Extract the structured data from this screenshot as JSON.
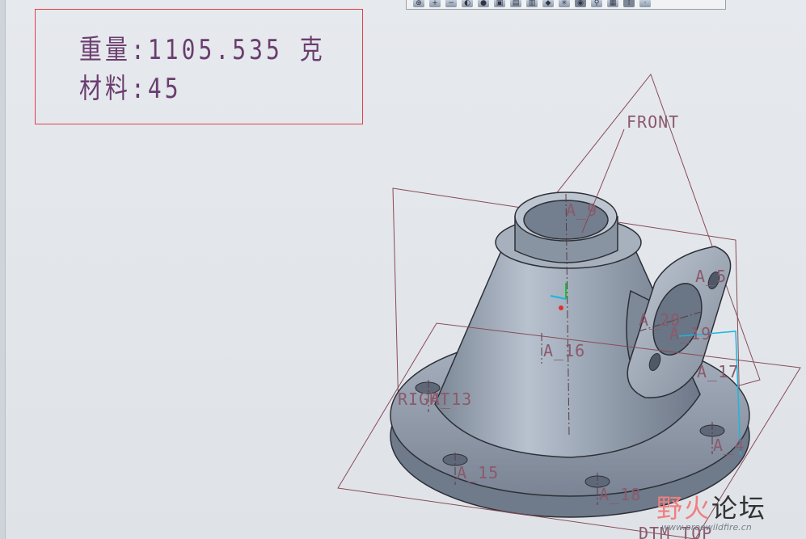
{
  "toolbar": {
    "icons": [
      {
        "name": "zoom-window-icon",
        "glyph": "⊕"
      },
      {
        "name": "zoom-in-icon",
        "glyph": "+"
      },
      {
        "name": "zoom-out-icon",
        "glyph": "−"
      },
      {
        "name": "repaint-icon",
        "glyph": "◐"
      },
      {
        "name": "shading-icon",
        "glyph": "●"
      },
      {
        "name": "view-manager-icon",
        "glyph": "▣"
      },
      {
        "name": "saved-views-icon",
        "glyph": "▤"
      },
      {
        "name": "display-style-icon",
        "glyph": "▥"
      },
      {
        "name": "perspective-icon",
        "glyph": "◆"
      },
      {
        "name": "datum-display-icon",
        "glyph": "✳"
      },
      {
        "name": "annotation-display-icon",
        "glyph": "◉"
      },
      {
        "name": "spin-center-icon",
        "glyph": "⚲"
      },
      {
        "name": "plane-display-icon",
        "glyph": "▦"
      },
      {
        "name": "axis-display-icon",
        "glyph": "⁞"
      },
      {
        "name": "point-display-icon",
        "glyph": "·"
      }
    ]
  },
  "note": {
    "weight_line": "重量:1105.535 克",
    "material_line": "材料:45"
  },
  "datums": {
    "front": "FRONT",
    "right": "RIGHT",
    "top": "DTM TOP",
    "axes": {
      "a9": "A_9",
      "a5": "A_5",
      "a16": "A_16",
      "a20": "A_20",
      "a19": "A_19",
      "a17": "A_17",
      "a13": "A_13",
      "a4": "A_4",
      "a15": "A_15",
      "a18": "A_18"
    }
  },
  "watermark": {
    "brand_red": "野火",
    "brand_dark": "论坛",
    "url": "www.proewildfire.cn"
  },
  "colors": {
    "datum_plane": "#8a4a55",
    "note_border": "#e0414b",
    "part_shade": "#8f9aa8",
    "selection_cyan": "#1ab6e0"
  }
}
